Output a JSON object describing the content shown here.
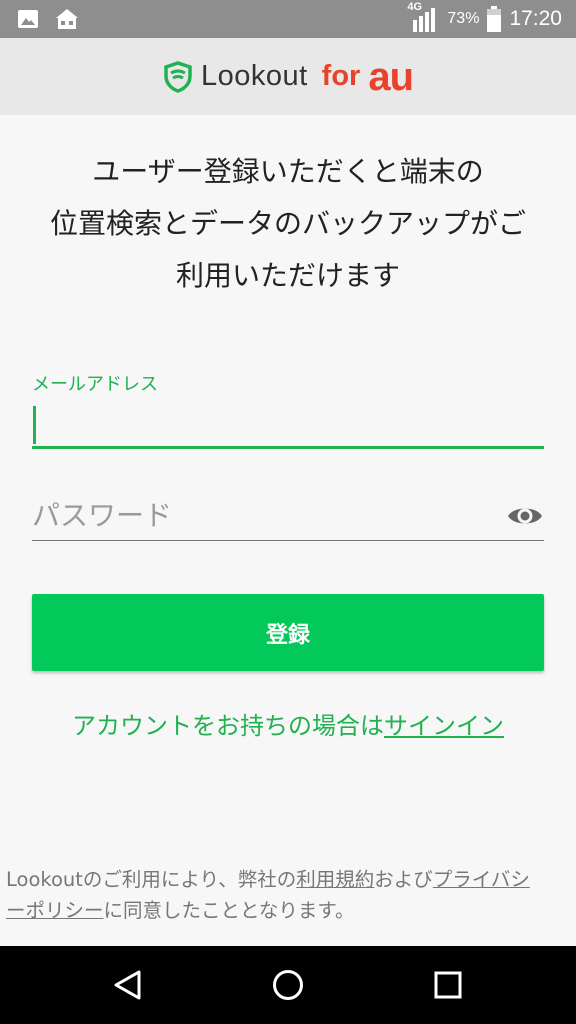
{
  "status_bar": {
    "network": "4G",
    "battery": "73%",
    "time": "17:20",
    "icons": [
      "gallery-icon",
      "home-icon",
      "signal-icon",
      "battery-icon"
    ]
  },
  "header": {
    "brand_name": "Lookout",
    "brand_for": "for",
    "brand_au": "au",
    "colors": {
      "shield": "#21b150",
      "au": "#e8422b"
    }
  },
  "intro": {
    "line1": "ユーザー登録いただくと端末の",
    "line2": "位置検索とデータのバックアップがご",
    "line3": "利用いただけます"
  },
  "form": {
    "email_label": "メールアドレス",
    "email_value": "",
    "password_placeholder": "パスワード",
    "password_value": "",
    "register_label": "登録"
  },
  "signin": {
    "prefix": "アカウントをお持ちの場合は",
    "link": "サインイン"
  },
  "legal": {
    "part1": "Lookoutのご利用により、弊社の",
    "terms_link": "利用規約",
    "part2": "および",
    "privacy_link_line1": "プライバシ",
    "privacy_link_line2": "ーポリシー",
    "part3": "に同意したこととなります。"
  },
  "colors": {
    "accent": "#21b150",
    "button": "#03c95a",
    "status_bar": "#8e8e8e",
    "header_bg": "#e8e8e8"
  }
}
